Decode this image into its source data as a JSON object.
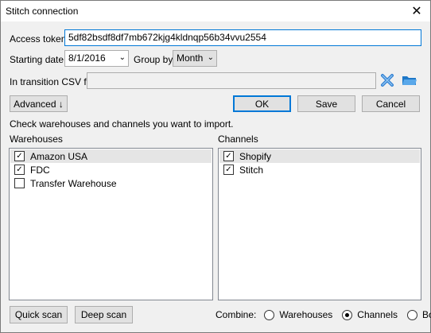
{
  "window": {
    "title": "Stitch connection"
  },
  "form": {
    "access_token_label": "Access token",
    "access_token_value": "5df82bsdf8df7mb672kjg4kldnqp56b34vvu2554",
    "starting_date_label": "Starting date",
    "starting_date_value": "8/1/2016",
    "group_by_label": "Group by",
    "group_by_value": "Month",
    "csv_label": "In transition CSV file",
    "csv_value": ""
  },
  "buttons": {
    "advanced": "Advanced ↓",
    "ok": "OK",
    "save": "Save",
    "cancel": "Cancel",
    "quick_scan": "Quick scan",
    "deep_scan": "Deep scan"
  },
  "instruction": "Check warehouses and channels you want to import.",
  "warehouses": {
    "label": "Warehouses",
    "items": [
      {
        "label": "Amazon USA",
        "checked": true,
        "selected": true
      },
      {
        "label": "FDC",
        "checked": true,
        "selected": false
      },
      {
        "label": "Transfer Warehouse",
        "checked": false,
        "selected": false
      }
    ]
  },
  "channels": {
    "label": "Channels",
    "items": [
      {
        "label": "Shopify",
        "checked": true,
        "selected": true
      },
      {
        "label": "Stitch",
        "checked": true,
        "selected": false
      }
    ]
  },
  "combine": {
    "label": "Combine:",
    "options": [
      {
        "label": "Warehouses",
        "selected": false
      },
      {
        "label": "Channels",
        "selected": true
      },
      {
        "label": "Both",
        "selected": false
      }
    ]
  },
  "icons": {
    "clear": "clear-x-icon",
    "browse": "folder-open-icon",
    "close": "close-icon",
    "dropdown": "chevron-down-icon"
  },
  "colors": {
    "focus": "#0078d7",
    "clear_icon": "#2f7fd1",
    "folder_icon": "#1e78c8"
  }
}
